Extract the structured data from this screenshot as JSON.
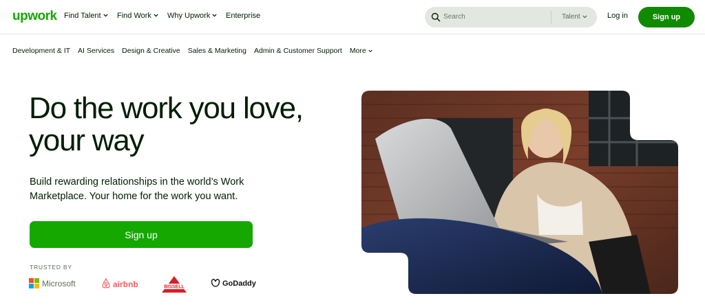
{
  "brand": {
    "logo_text": "upwork",
    "accent": "#14a800",
    "accent_dark": "#108a00"
  },
  "topnav": {
    "items": [
      {
        "label": "Find Talent",
        "dropdown": true
      },
      {
        "label": "Find Work",
        "dropdown": true
      },
      {
        "label": "Why Upwork",
        "dropdown": true
      },
      {
        "label": "Enterprise",
        "dropdown": false
      }
    ],
    "search": {
      "placeholder": "Search",
      "scope": "Talent"
    },
    "login_label": "Log in",
    "signup_label": "Sign up"
  },
  "categories": {
    "items": [
      "Development & IT",
      "AI Services",
      "Design & Creative",
      "Sales & Marketing",
      "Admin & Customer Support"
    ],
    "more_label": "More"
  },
  "hero": {
    "headline_line1": "Do the work you love,",
    "headline_line2": "your way",
    "subtext_line1": "Build rewarding relationships in the world’s Work",
    "subtext_line2": "Marketplace. Your home for the work you want.",
    "cta_label": "Sign up",
    "trusted_by": "TRUSTED BY",
    "trusted_logos": [
      "Microsoft",
      "airbnb",
      "BISSELL",
      "GoDaddy"
    ]
  }
}
